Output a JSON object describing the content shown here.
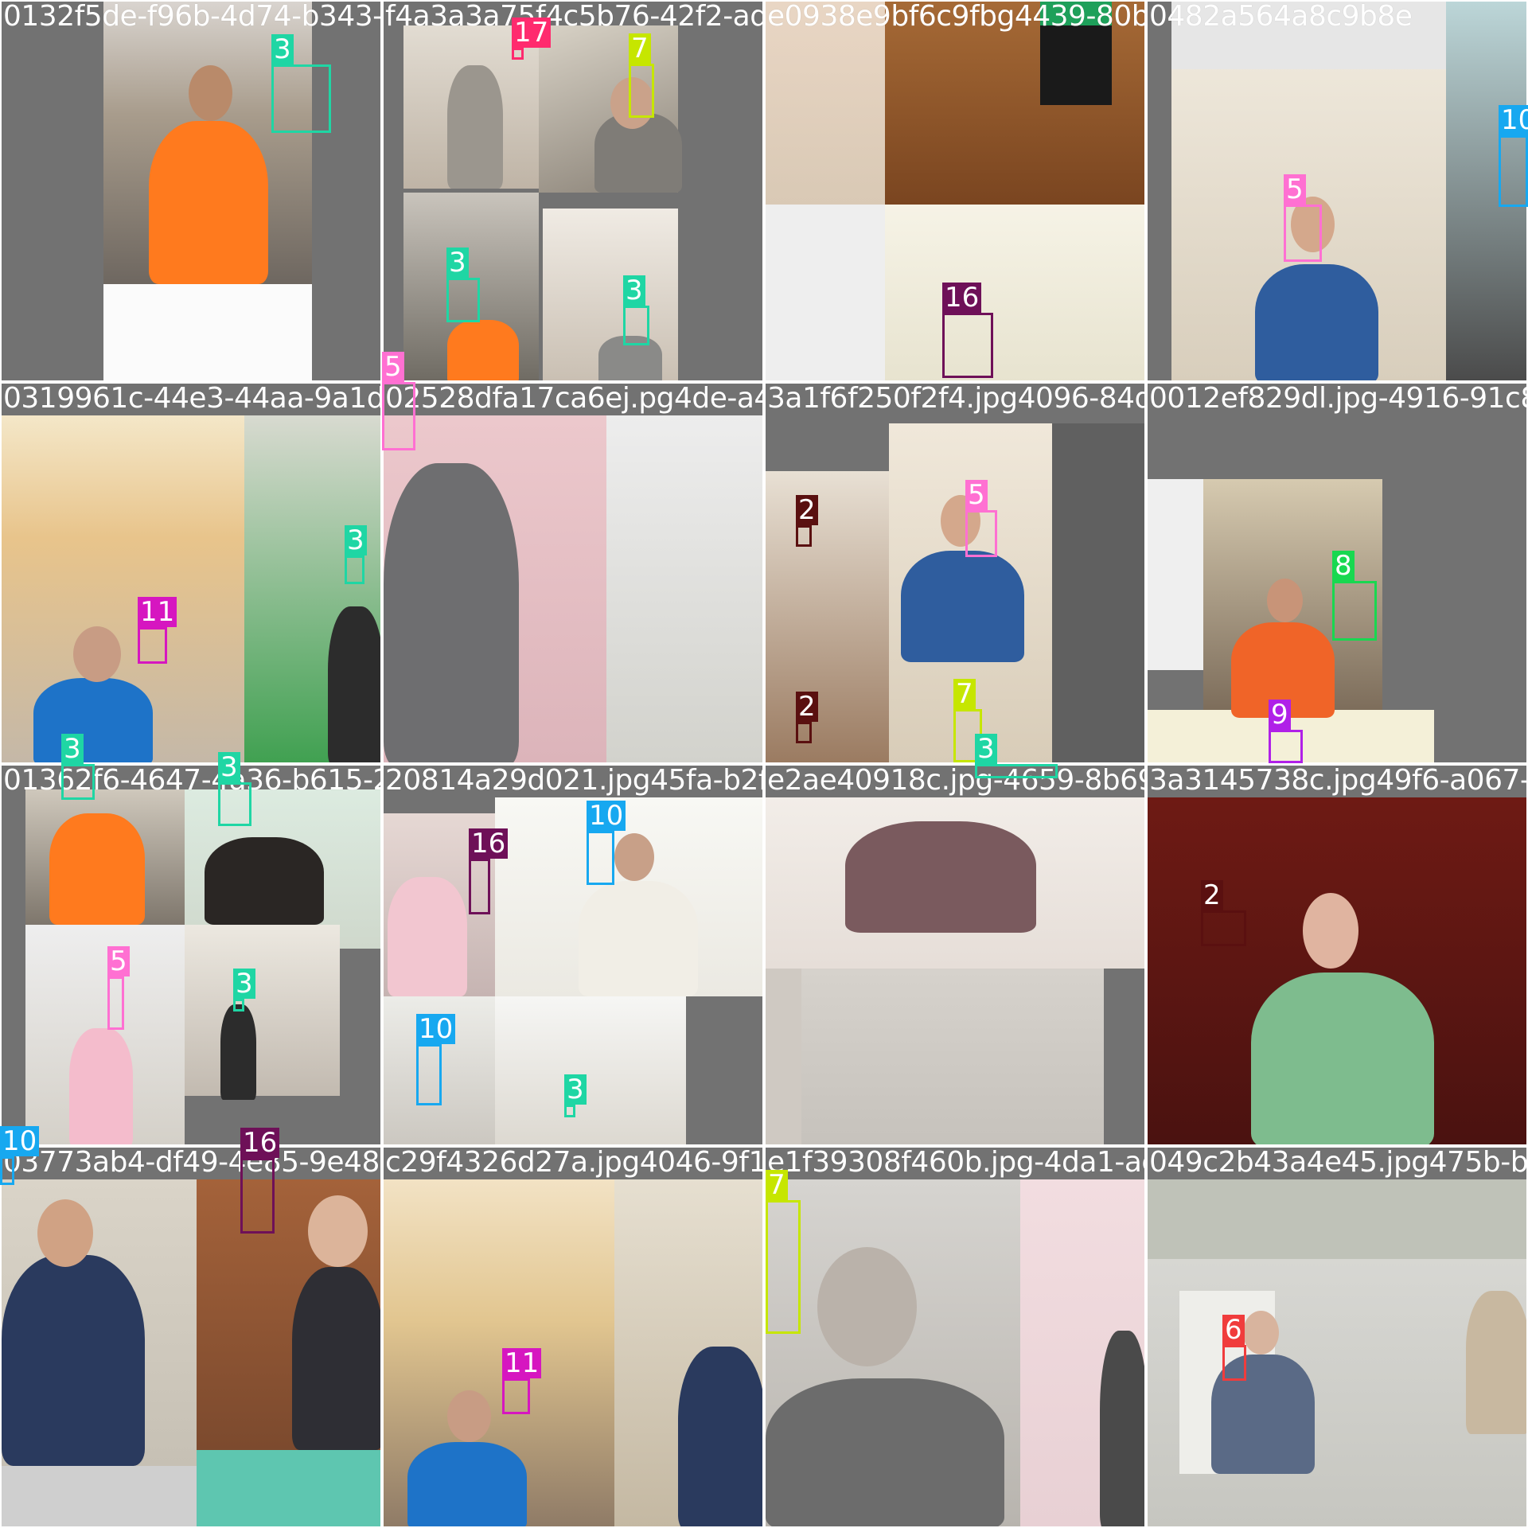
{
  "tiles": [
    {
      "filename": "0132f5de-f96b-4d74-b343-75f4a3a3a75fbg-42f2-adef-8e0938e9bf6c9f.jpg4439-80be-20482a564a8c9b8e"
    },
    {
      "filename": "f4a3a3a75f4c5b76-42f2-adef-8"
    },
    {
      "filename": "e0938e9bf6c9fbg4439-80be-2"
    },
    {
      "filename": "0482a564a8c9b8e"
    },
    {
      "filename": "0319961c-44e3-44aa-9a1d-3f2528dfa17ca6e.jpg4de-a494-3a1f6f250f2f4.jpg"
    },
    {
      "filename": "02528dfa17ca6ej.pg4de-a494-5a1f6f250f2f4"
    },
    {
      "filename": "3a1f6f250f2f4.jpg4096-84df-f0d0012ef829d.jpg"
    },
    {
      "filename": "0012ef829dl.jpg-4916-91c8-8"
    },
    {
      "filename": "01362f6-4647-4a36-b615-20814a29d021.jpg45fa-b2f8-bfe2ae4091e0.jpg"
    },
    {
      "filename": "20814a29d021.jpg45fa-b2f8-bfe"
    },
    {
      "filename": "e2ae40918c.jpg-4659-8b69-4e3a3145738c.jpg49f6-a067-3"
    },
    {
      "filename": "3a3145738c.jpg49f6-a067-3"
    },
    {
      "filename": "03773ab4-df49-4e85-9e48-7c29f4326d27a.jpg4046-9f16-7e1f39308f460b"
    },
    {
      "filename": "c29f4326d27a.jpg4046-9f16-7"
    },
    {
      "filename": "e1f39308f460b.jpg-4da1-ac67-b"
    },
    {
      "filename": "049c2b43a4e45.jpg475b-bfbc-2"
    }
  ],
  "detections": [
    {
      "label": "3",
      "color": "#1fd6a4"
    },
    {
      "label": "17",
      "color": "#ff2a6e"
    },
    {
      "label": "7",
      "color": "#c6e600"
    },
    {
      "label": "3",
      "color": "#1fd6a4"
    },
    {
      "label": "3",
      "color": "#1fd6a4"
    },
    {
      "label": "16",
      "color": "#6e1058"
    },
    {
      "label": "10",
      "color": "#17a8f0"
    },
    {
      "label": "5",
      "color": "#ff70d2"
    },
    {
      "label": "5",
      "color": "#ff70d2"
    },
    {
      "label": "3",
      "color": "#1fd6a4"
    },
    {
      "label": "11",
      "color": "#d616c0"
    },
    {
      "label": "3",
      "color": "#1fd6a4"
    },
    {
      "label": "2",
      "color": "#5a1010"
    },
    {
      "label": "5",
      "color": "#ff70d2"
    },
    {
      "label": "2",
      "color": "#5a1010"
    },
    {
      "label": "7",
      "color": "#c6e600"
    },
    {
      "label": "3",
      "color": "#1fd6a4"
    },
    {
      "label": "8",
      "color": "#18d850"
    },
    {
      "label": "9",
      "color": "#b020e8"
    },
    {
      "label": "3",
      "color": "#1fd6a4"
    },
    {
      "label": "3",
      "color": "#1fd6a4"
    },
    {
      "label": "5",
      "color": "#ff70d2"
    },
    {
      "label": "3",
      "color": "#1fd6a4"
    },
    {
      "label": "16",
      "color": "#6e1058"
    },
    {
      "label": "10",
      "color": "#17a8f0"
    },
    {
      "label": "10",
      "color": "#17a8f0"
    },
    {
      "label": "3",
      "color": "#1fd6a4"
    },
    {
      "label": "2",
      "color": "#5a1010"
    },
    {
      "label": "10",
      "color": "#17a8f0"
    },
    {
      "label": "16",
      "color": "#6e1058"
    },
    {
      "label": "11",
      "color": "#d616c0"
    },
    {
      "label": "7",
      "color": "#c6e600"
    },
    {
      "label": "6",
      "color": "#f03c3c"
    }
  ]
}
